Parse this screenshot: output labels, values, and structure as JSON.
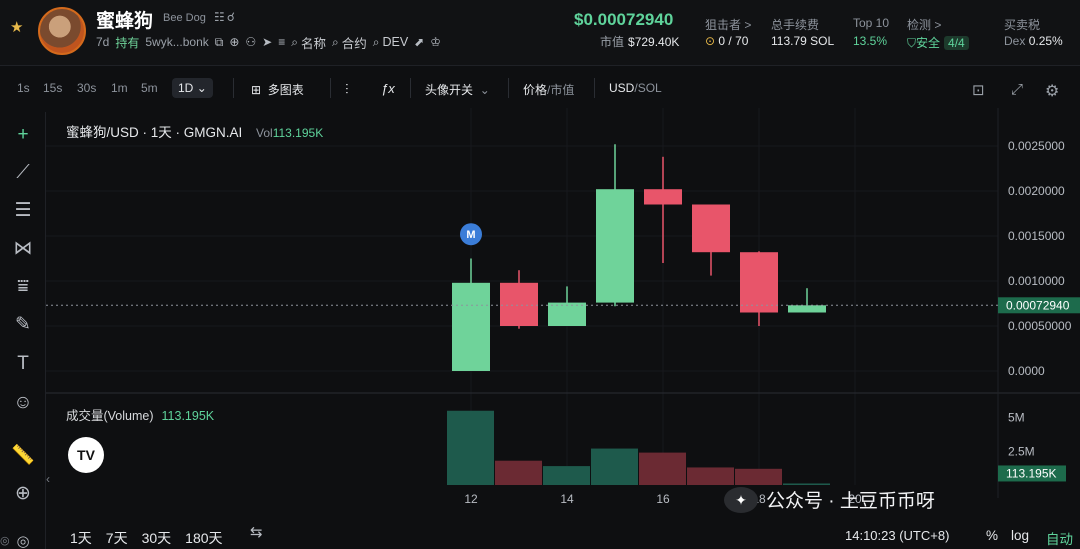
{
  "header": {
    "token_name": "蜜蜂狗",
    "token_sub": "Bee Dog",
    "age": "7d",
    "holding_label": "持有",
    "address": "5wyk...bonk",
    "search_links": [
      "名称",
      "合约",
      "DEV"
    ],
    "price": "$0.00072940",
    "mcap_label": "市值",
    "mcap_value": "$729.40K",
    "stats": [
      {
        "label": "狙击者 >",
        "value": "0 / 70"
      },
      {
        "label": "总手续费",
        "value": "113.79 SOL"
      },
      {
        "label": "Top 10",
        "value": "13.5%"
      },
      {
        "label": "检测 >",
        "value": "安全",
        "badge": "4/4"
      },
      {
        "label": "买卖税",
        "value_prefix": "Dex",
        "value": "0.25%"
      }
    ]
  },
  "toolbar": {
    "timeframes": [
      "1s",
      "15s",
      "30s",
      "1m",
      "5m"
    ],
    "active_timeframe": "1D",
    "multi_chart": "多图表",
    "avatar_toggle": "头像开关",
    "price_label": "价格",
    "mcap_label": "市值",
    "currency_a": "USD",
    "currency_b": "SOL"
  },
  "chart": {
    "legend_title": "蜜蜂狗/USD · 1天 · GMGN.AI",
    "vol_label": "Vol",
    "vol_value": "113.195K",
    "volume_legend": "成交量(Volume)",
    "volume_legend_value": "113.195K",
    "marker_label": "M",
    "current_price_tag": "0.00072940",
    "current_volume_tag": "113.195K",
    "x_ticks": [
      "12",
      "14",
      "16",
      "18",
      "20"
    ],
    "price_ticks": [
      "0.0025000",
      "0.0020000",
      "0.0015000",
      "0.0010000",
      "0.00050000",
      "0.0000"
    ],
    "volume_ticks": [
      "5M",
      "2.5M"
    ]
  },
  "chart_data": {
    "type": "candlestick",
    "x": [
      "12",
      "13",
      "14",
      "15",
      "16",
      "17",
      "18",
      "19"
    ],
    "candles": [
      {
        "open": 0.0,
        "high": 0.00125,
        "low": 0.0,
        "close": 0.00098
      },
      {
        "open": 0.00098,
        "high": 0.00112,
        "low": 0.00047,
        "close": 0.0005
      },
      {
        "open": 0.0005,
        "high": 0.00094,
        "low": 0.0005,
        "close": 0.00076
      },
      {
        "open": 0.00076,
        "high": 0.00252,
        "low": 0.00072,
        "close": 0.00202
      },
      {
        "open": 0.00202,
        "high": 0.00238,
        "low": 0.0012,
        "close": 0.00185
      },
      {
        "open": 0.00185,
        "high": 0.00185,
        "low": 0.00106,
        "close": 0.00132
      },
      {
        "open": 0.00132,
        "high": 0.00133,
        "low": 0.0005,
        "close": 0.00065
      },
      {
        "open": 0.00065,
        "high": 0.00092,
        "low": 0.00065,
        "close": 0.00073
      }
    ],
    "volume": [
      5500000,
      1800000,
      1400000,
      2700000,
      2400000,
      1300000,
      1200000,
      113195
    ],
    "ylim": [
      0,
      0.0027
    ],
    "volume_max": 6000000,
    "up_color": "#6fd39a",
    "down_color": "#e8556a",
    "volume_up_color": "#1e5a4c",
    "volume_down_color": "#6b2a33"
  },
  "footer": {
    "ranges": [
      "1天",
      "7天",
      "30天",
      "180天"
    ],
    "clock": "14:10:23 (UTC+8)",
    "percent": "%",
    "log": "log",
    "auto": "自动"
  },
  "watermark": {
    "text": "公众号 · 土豆币币呀",
    "icon_text": "✦"
  }
}
